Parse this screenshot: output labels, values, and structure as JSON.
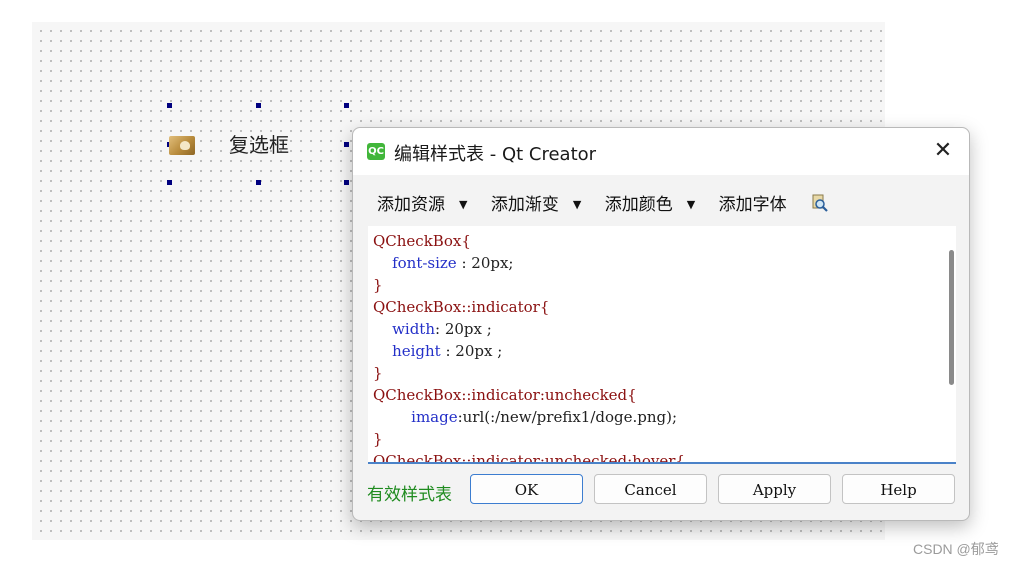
{
  "designer": {
    "checkbox_label": "复选框"
  },
  "dialog": {
    "app_icon_text": "QC",
    "title": "编辑样式表 - Qt Creator",
    "close_symbol": "✕",
    "toolbar": {
      "add_resource": "添加资源",
      "add_gradient": "添加渐变",
      "add_color": "添加颜色",
      "add_font": "添加字体",
      "dropdown_arrow": "▼"
    },
    "code_lines": [
      {
        "sel": "QCheckBox{",
        "prop": "",
        "val": ""
      },
      {
        "sel": "",
        "prop": "    font-size",
        "val": " : 20px;"
      },
      {
        "sel": "}",
        "prop": "",
        "val": ""
      },
      {
        "sel": "QCheckBox::indicator{",
        "prop": "",
        "val": ""
      },
      {
        "sel": "",
        "prop": "    width",
        "val": ": 20px ;"
      },
      {
        "sel": "",
        "prop": "    height",
        "val": " : 20px ;"
      },
      {
        "sel": "}",
        "prop": "",
        "val": ""
      },
      {
        "sel": "QCheckBox::indicator:unchecked{",
        "prop": "",
        "val": ""
      },
      {
        "sel": "",
        "prop": "        image",
        "val": ":url(:/new/prefix1/doge.png);"
      },
      {
        "sel": "}",
        "prop": "",
        "val": ""
      },
      {
        "sel": "QCheckBox::indicator:unchecked:hover{",
        "prop": "",
        "val": ""
      }
    ],
    "status": "有效样式表",
    "buttons": {
      "ok": "OK",
      "cancel": "Cancel",
      "apply": "Apply",
      "help": "Help"
    }
  },
  "watermark": "CSDN @郁鸢",
  "colors": {
    "selector": "#8a1010",
    "property": "#2430c8",
    "valid_status": "#1f8b1f",
    "selection_handle": "#00007f"
  }
}
